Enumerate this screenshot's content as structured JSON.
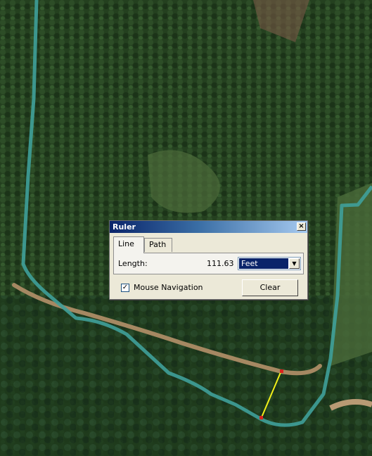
{
  "map": {
    "background": "#2f4a2a",
    "trail_color": "#3fa09a",
    "road_color": "#a58862",
    "ruler_line_color": "#f2ef1a",
    "ruler_point_color": "#d8241f"
  },
  "dialog": {
    "title": "Ruler",
    "close_glyph": "×",
    "tabs": [
      {
        "label": "Line",
        "active": true
      },
      {
        "label": "Path",
        "active": false
      }
    ],
    "length_label": "Length:",
    "length_value": "111.63",
    "units_selected": "Feet",
    "mouse_nav_label": "Mouse Navigation",
    "mouse_nav_checked_glyph": "✓",
    "clear_label": "Clear"
  }
}
